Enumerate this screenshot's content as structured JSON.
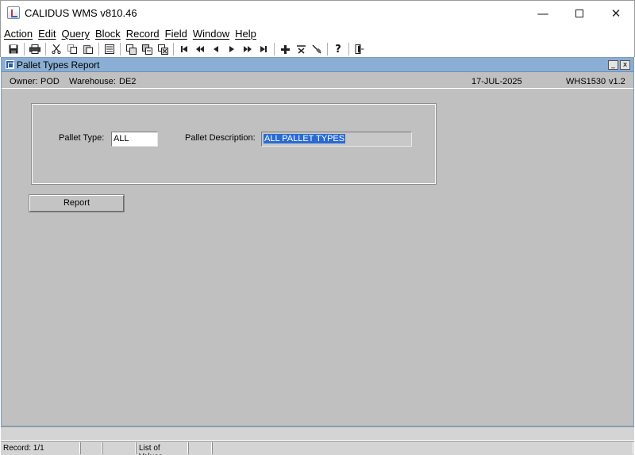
{
  "window": {
    "title": "CALIDUS WMS v810.46",
    "min_glyph": "—",
    "close_glyph": "✕"
  },
  "menu": [
    "Action",
    "Edit",
    "Query",
    "Block",
    "Record",
    "Field",
    "Window",
    "Help"
  ],
  "toolbar": {
    "help_glyph": "?"
  },
  "form": {
    "title": "Pallet Types Report",
    "min_glyph": "_",
    "close_glyph": "x",
    "owner_label": "Owner:",
    "owner_value": "POD",
    "warehouse_label": "Warehouse:",
    "warehouse_value": "DE2",
    "date": "17-JUL-2025",
    "module": "WHS1530",
    "version": "v1.2",
    "pallet_type_label": "Pallet Type:",
    "pallet_type_value": "ALL",
    "pallet_desc_label": "Pallet Description:",
    "pallet_desc_value": "ALL PALLET TYPES",
    "report_button": "Report"
  },
  "status": {
    "record": "Record: 1/1",
    "lov": "List of Values"
  }
}
